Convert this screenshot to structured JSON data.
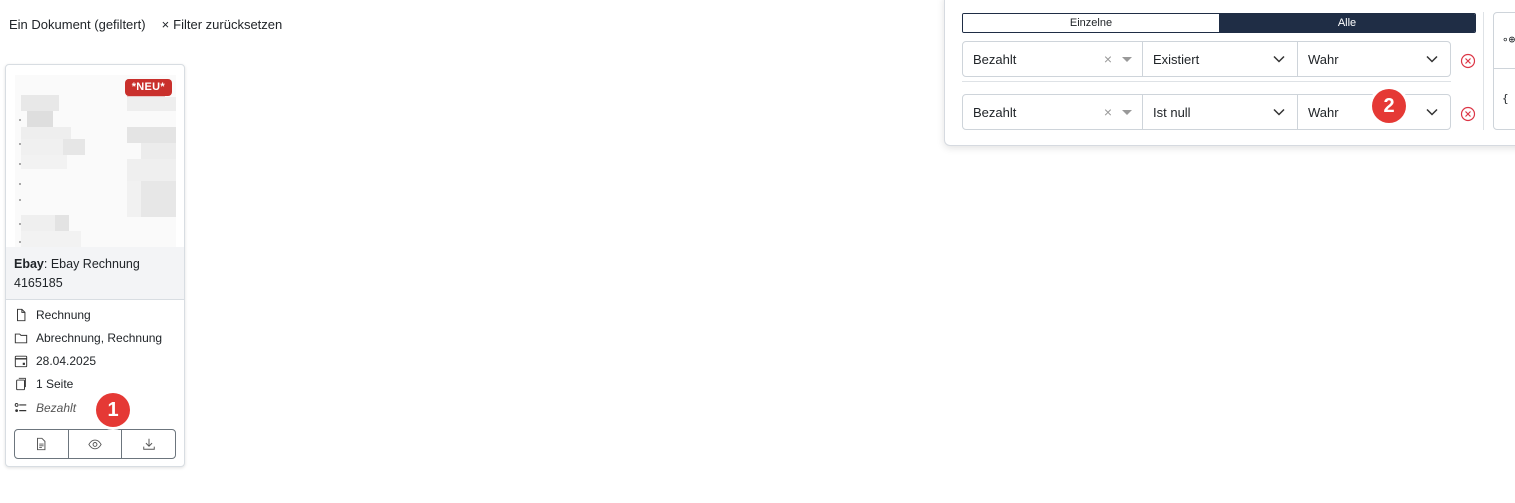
{
  "header": {
    "count_label": "Ein Dokument (gefiltert)",
    "reset_icon": "×",
    "reset_label": "Filter zurücksetzen"
  },
  "card": {
    "badge": "*NEU*",
    "correspondent": "Ebay",
    "title": "Ebay Rechnung 4165185",
    "doc_type": "Rechnung",
    "tags": "Abrechnung, Rechnung",
    "date": "28.04.2025",
    "pages": "1 Seite",
    "custom_field": "Bezahlt",
    "icons": {
      "doc_type": "file-icon",
      "tags": "folder-icon",
      "date": "calendar-icon",
      "pages": "pages-icon",
      "custom_field": "custom-field-icon",
      "details": "document-details-icon",
      "preview": "eye-icon",
      "download": "download-icon"
    }
  },
  "filter": {
    "toggle": {
      "single": "Einzelne",
      "all": "Alle",
      "active": "all"
    },
    "rules": [
      {
        "field": "Bezahlt",
        "operator": "Existiert",
        "value": "Wahr"
      },
      {
        "field": "Bezahlt",
        "operator": "Ist null",
        "value": "Wahr"
      }
    ],
    "side": {
      "glyph1": "∘⊕",
      "glyph2": "{ }"
    }
  },
  "markers": {
    "m1": "1",
    "m2": "2"
  },
  "colors": {
    "accent": "#1f2d45",
    "badge": "#c9302c",
    "marker": "#e53935",
    "remove": "#dc3545"
  }
}
